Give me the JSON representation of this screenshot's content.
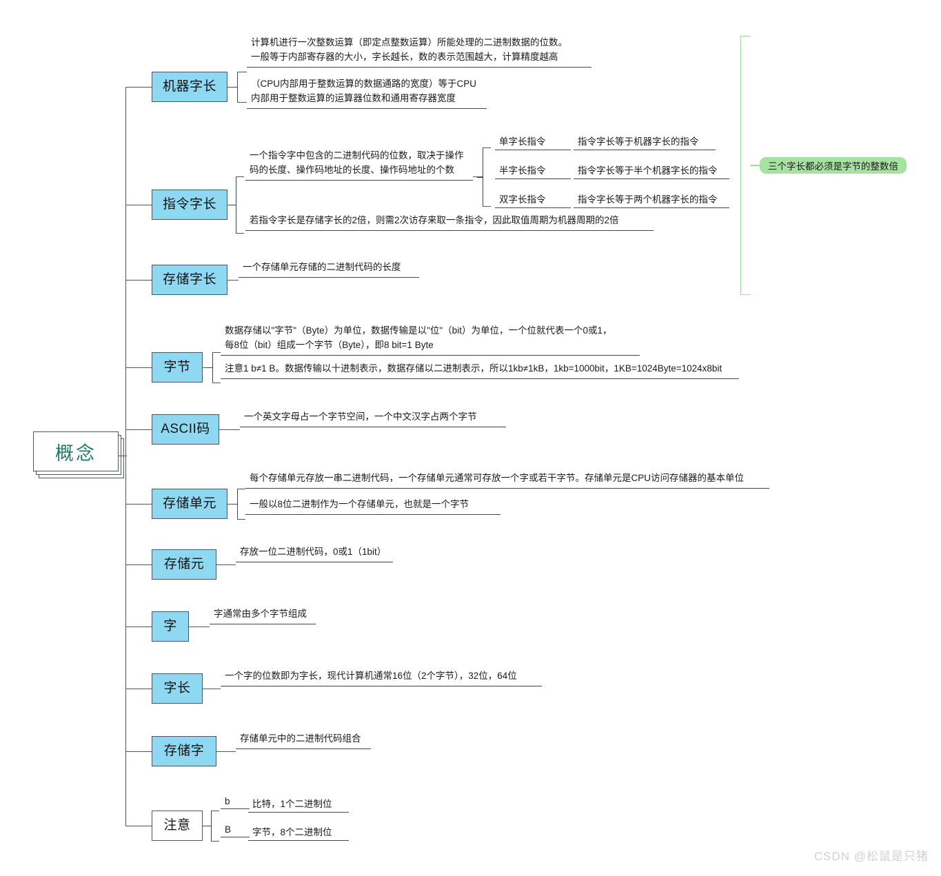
{
  "root": {
    "label": "概念"
  },
  "watermark": "CSDN @松鼠是只猪",
  "highlight": {
    "label": "三个字长都必须是字节的整数倍"
  },
  "branches": [
    {
      "id": "machine-word-length",
      "label": "机器字长",
      "descs": [
        "计算机进行一次整数运算（即定点整数运算）所能处理的二进制数据的位数。\n一般等于内部寄存器的大小，字长越长，数的表示范围越大，计算精度越高",
        "（CPU内部用于整数运算的数据通路的宽度）等于CPU\n内部用于整数运算的运算器位数和通用寄存器宽度"
      ]
    },
    {
      "id": "instruction-word-length",
      "label": "指令字长",
      "descs": [
        "一个指令字中包含的二进制代码的位数，取决于操作\n码的长度、操作码地址的长度、操作码地址的个数",
        "若指令字长是存储字长的2倍，则需2次访存来取一条指令，因此取值周期为机器周期的2倍"
      ],
      "table": [
        {
          "label": "单字长指令",
          "value": "指令字长等于机器字长的指令"
        },
        {
          "label": "半字长指令",
          "value": "指令字长等于半个机器字长的指令"
        },
        {
          "label": "双字长指令",
          "value": "指令字长等于两个机器字长的指令"
        }
      ]
    },
    {
      "id": "storage-word-length",
      "label": "存储字长",
      "descs": [
        "一个存储单元存储的二进制代码的长度"
      ]
    },
    {
      "id": "byte",
      "label": "字节",
      "descs": [
        "数据存储以\"字节\"（Byte）为单位，数据传输是以\"位\"（bit）为单位，一个位就代表一个0或1，\n每8位（bit）组成一个字节（Byte），即8 bit=1 Byte",
        "注意1 b≠1 B。数据传输以十进制表示，数据存储以二进制表示，所以1kb≠1kB，1kb=1000bit，1KB=1024Byte=1024x8bit"
      ]
    },
    {
      "id": "ascii-code",
      "label": "ASCII码",
      "descs": [
        "一个英文字母占一个字节空间，一个中文汉字占两个字节"
      ]
    },
    {
      "id": "storage-unit",
      "label": "存储单元",
      "descs": [
        "每个存储单元存放一串二进制代码，一个存储单元通常可存放一个字或若干字节。存储单元是CPU访问存储器的基本单位",
        "一般以8位二进制作为一个存储单元，也就是一个字节"
      ]
    },
    {
      "id": "storage-element",
      "label": "存储元",
      "descs": [
        "存放一位二进制代码，0或1（1bit）"
      ]
    },
    {
      "id": "word",
      "label": "字",
      "descs": [
        "字通常由多个字节组成"
      ]
    },
    {
      "id": "word-length",
      "label": "字长",
      "descs": [
        "一个字的位数即为字长，现代计算机通常16位（2个字节），32位，64位"
      ]
    },
    {
      "id": "storage-word",
      "label": "存储字",
      "descs": [
        "存储单元中的二进制代码组合"
      ]
    },
    {
      "id": "note",
      "label": "注意",
      "table": [
        {
          "label": "b",
          "value": "比特，1个二进制位"
        },
        {
          "label": "B",
          "value": "字节，8个二进制位"
        }
      ]
    }
  ]
}
